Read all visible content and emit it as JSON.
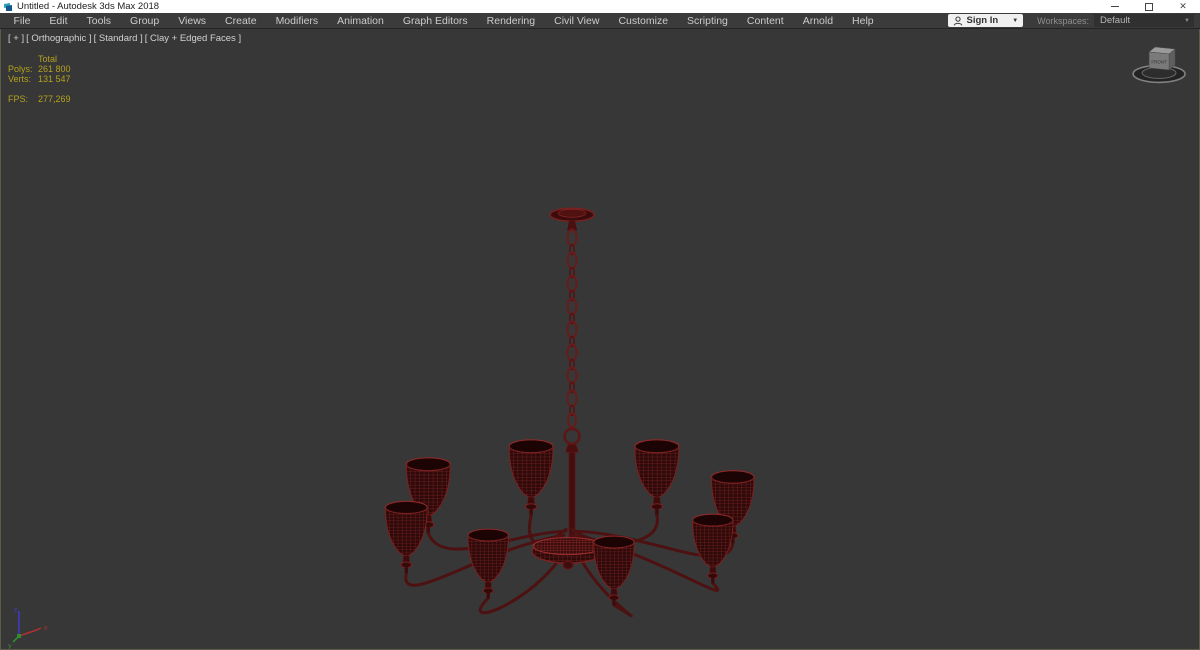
{
  "window": {
    "title": "Untitled - Autodesk 3ds Max 2018"
  },
  "menubar": {
    "items": [
      "File",
      "Edit",
      "Tools",
      "Group",
      "Views",
      "Create",
      "Modifiers",
      "Animation",
      "Graph Editors",
      "Rendering",
      "Civil View",
      "Customize",
      "Scripting",
      "Content",
      "Arnold",
      "Help"
    ],
    "sign_in": {
      "label": "Sign In"
    },
    "workspaces": {
      "label": "Workspaces:",
      "value": "Default"
    }
  },
  "viewport": {
    "label": {
      "general": "[ + ]",
      "pov": "[ Orthographic ]",
      "shading_quality": "[ Standard ]",
      "shading_mode": "[ Clay + Edged Faces ]"
    },
    "statistics": {
      "header": "Total",
      "rows": [
        {
          "label": "Polys:",
          "value": "261 800"
        },
        {
          "label": "Verts:",
          "value": "131 547"
        }
      ],
      "fps": {
        "label": "FPS:",
        "value": "277,269"
      }
    },
    "viewcube": {
      "front": "FRONT"
    },
    "axis_tripod": {
      "x": "x",
      "y": "y",
      "z": "z"
    },
    "scene_object": "chandelier-wireframe-model"
  },
  "colors": {
    "titlebar_bg": "#ffffff",
    "menubar_bg": "#3b3b3b",
    "viewport_bg": "#373737",
    "viewport_border": "#5c5c49",
    "stats_text": "#b3a21f",
    "wire_bright": "#8d2a2a",
    "wire_dark": "#2e0a0a",
    "arm_color": "#4d1111",
    "axis_x": "#b03030",
    "axis_y": "#2f8f2f",
    "axis_z": "#3c3cc0"
  }
}
